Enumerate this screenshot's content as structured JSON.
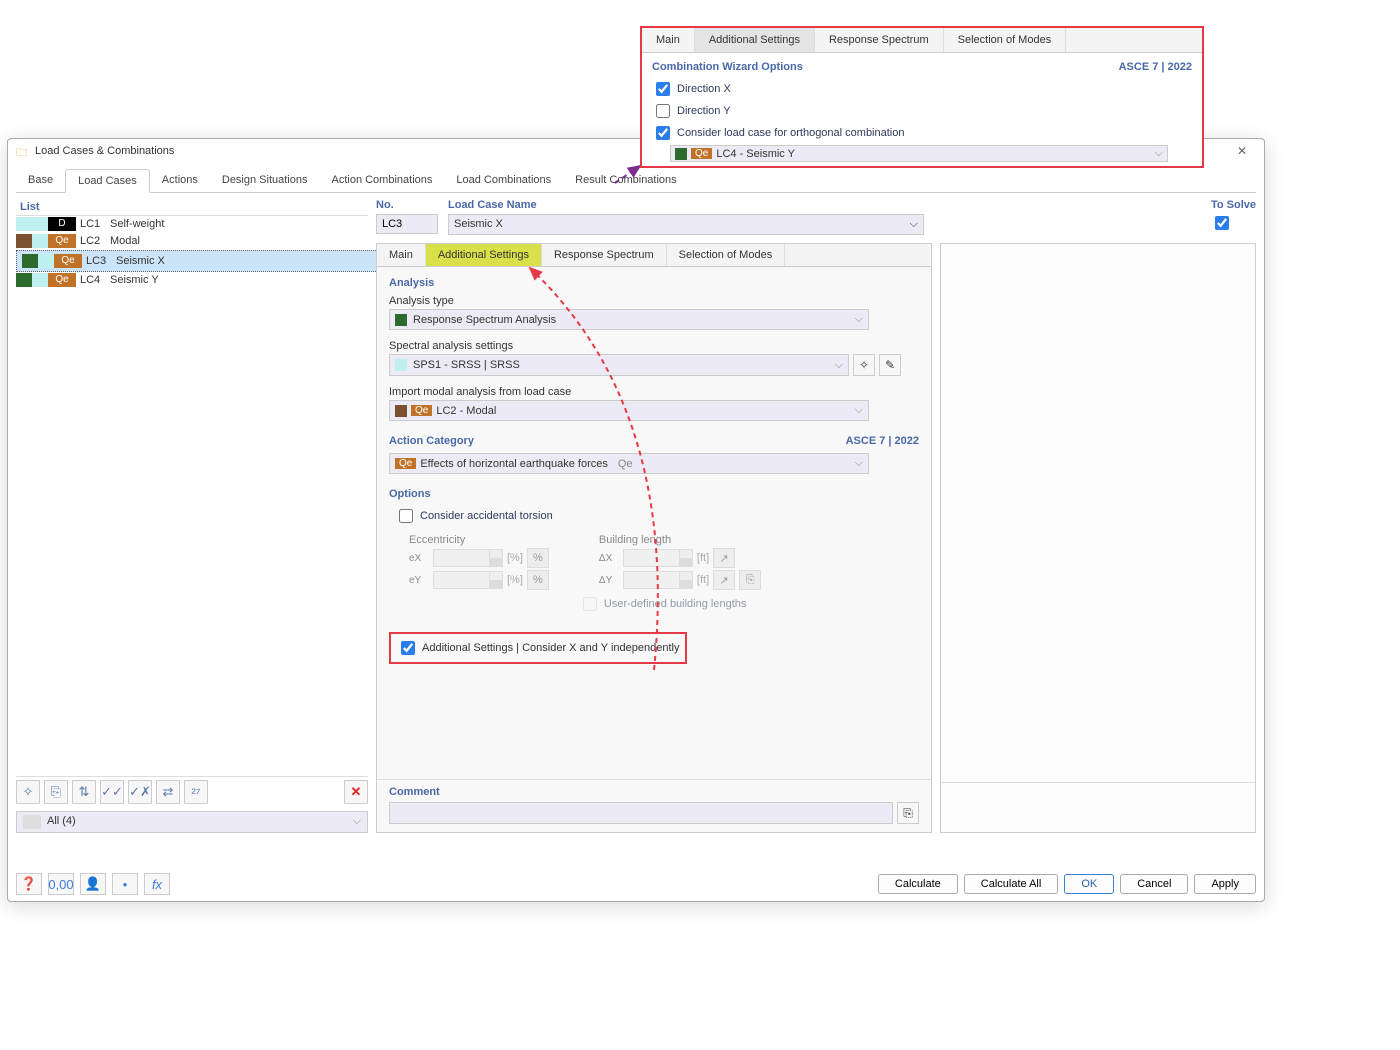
{
  "callout": {
    "tabs": [
      "Main",
      "Additional Settings",
      "Response Spectrum",
      "Selection of Modes"
    ],
    "activeTab": 1,
    "header": "Combination Wizard Options",
    "standard": "ASCE 7 | 2022",
    "dirX": "Direction X",
    "dirY": "Direction Y",
    "consider": "Consider load case for orthogonal combination",
    "loadCase": "LC4 - Seismic Y",
    "badge": "Qe"
  },
  "dialog": {
    "title": "Load Cases & Combinations",
    "mainTabs": [
      "Base",
      "Load Cases",
      "Actions",
      "Design Situations",
      "Action Combinations",
      "Load Combinations",
      "Result Combinations"
    ],
    "activeMainTab": 1,
    "list": {
      "header": "List",
      "items": [
        {
          "id": "LC1",
          "name": "Self-weight",
          "badge": "D",
          "c1": "#bff0f0",
          "c2": "#bff0f0",
          "c3": "#000000"
        },
        {
          "id": "LC2",
          "name": "Modal",
          "badge": "Qe",
          "c1": "#7a5230",
          "c2": "#bff0f0",
          "c3": "#c07228"
        },
        {
          "id": "LC3",
          "name": "Seismic X",
          "badge": "Qe",
          "c1": "#2d6a2d",
          "c2": "#bff0f0",
          "c3": "#c07228",
          "sel": true
        },
        {
          "id": "LC4",
          "name": "Seismic Y",
          "badge": "Qe",
          "c1": "#2d6a2d",
          "c2": "#bff0f0",
          "c3": "#c07228"
        }
      ],
      "filter": "All (4)"
    },
    "top": {
      "noLabel": "No.",
      "noValue": "LC3",
      "nameLabel": "Load Case Name",
      "nameValue": "Seismic X",
      "solveLabel": "To Solve"
    },
    "detail": {
      "tabs": [
        "Main",
        "Additional Settings",
        "Response Spectrum",
        "Selection of Modes"
      ],
      "activeTab": 1,
      "analysis": {
        "header": "Analysis",
        "typeLabel": "Analysis type",
        "typeValue": "Response Spectrum Analysis",
        "spectralLabel": "Spectral analysis settings",
        "spectralValue": "SPS1 - SRSS | SRSS",
        "importLabel": "Import modal analysis from load case",
        "importValue": "LC2 - Modal",
        "importBadge": "Qe"
      },
      "actionCat": {
        "header": "Action Category",
        "standard": "ASCE 7 | 2022",
        "value": "Effects of horizontal earthquake forces",
        "badge": "Qe",
        "suffix": "Qe"
      },
      "options": {
        "header": "Options",
        "torsion": "Consider accidental torsion",
        "eccLabel": "Eccentricity",
        "ex": "eX",
        "ey": "eY",
        "pct": "[%]",
        "pctBtn": "%",
        "buildLabel": "Building length",
        "dx": "ΔX",
        "dy": "ΔY",
        "ft": "[ft]",
        "userDef": "User-defined building lengths",
        "addSettings": "Additional Settings | Consider X and Y independently"
      },
      "commentLabel": "Comment"
    },
    "footerButtons": {
      "calculate": "Calculate",
      "calculateAll": "Calculate All",
      "ok": "OK",
      "cancel": "Cancel",
      "apply": "Apply"
    }
  }
}
